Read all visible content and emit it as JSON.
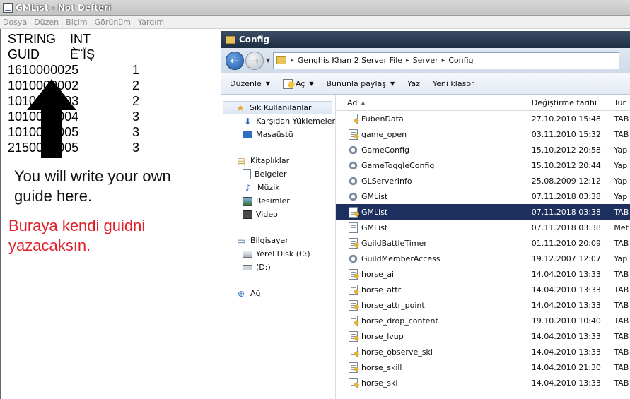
{
  "notepad": {
    "title": "GMList - Not Defteri",
    "menu": [
      "Dosya",
      "Düzen",
      "Biçim",
      "Görünüm",
      "Yardım"
    ],
    "lines": [
      [
        "STRING",
        "INT",
        ""
      ],
      [
        "GUID",
        "È¨ÏŞ",
        ""
      ],
      [
        "1610000025",
        "",
        "1"
      ],
      [
        "1010000002",
        "",
        "2"
      ],
      [
        "1010000003",
        "",
        "2"
      ],
      [
        "1010000004",
        "",
        "3"
      ],
      [
        "1010000005",
        "",
        "3"
      ],
      [
        "2150000005",
        "",
        "3"
      ]
    ],
    "note_en": "You will write your own guide here.",
    "note_tr": "Buraya kendi guidni yazacaksın."
  },
  "explorer": {
    "title": "Config",
    "address": [
      "Genghis Khan 2 Server File",
      "Server",
      "Config"
    ],
    "toolbar": {
      "organize": "Düzenle",
      "open": "Aç",
      "share": "Bununla paylaş",
      "print": "Yaz",
      "new_folder": "Yeni klasör"
    },
    "nav": {
      "favorites": "Sık Kullanılanlar",
      "downloads": "Karşıdan Yüklemeler",
      "desktop": "Masaüstü",
      "libraries": "Kitaplıklar",
      "documents": "Belgeler",
      "music": "Müzik",
      "pictures": "Resimler",
      "video": "Video",
      "computer": "Bilgisayar",
      "local_disk": "Yerel Disk (C:)",
      "drive_d": "(D:)",
      "network": "Ağ"
    },
    "columns": {
      "name": "Ad",
      "date": "Değiştirme tarihi",
      "type": "Tür"
    },
    "files": [
      {
        "name": "FubenData",
        "date": "27.10.2010 15:48",
        "type": "TAB",
        "icon": "txt"
      },
      {
        "name": "game_open",
        "date": "03.11.2010 15:32",
        "type": "TAB",
        "icon": "txt"
      },
      {
        "name": "GameConfig",
        "date": "15.10.2012 20:58",
        "type": "Yap",
        "icon": "cfg"
      },
      {
        "name": "GameToggleConfig",
        "date": "15.10.2012 20:44",
        "type": "Yap",
        "icon": "cfg"
      },
      {
        "name": "GLServerInfo",
        "date": "25.08.2009 12:12",
        "type": "Yap",
        "icon": "cfg"
      },
      {
        "name": "GMList",
        "date": "07.11.2018 03:38",
        "type": "Yap",
        "icon": "cfg"
      },
      {
        "name": "GMList",
        "date": "07.11.2018 03:38",
        "type": "TAB",
        "icon": "txt",
        "selected": true
      },
      {
        "name": "GMList",
        "date": "07.11.2018 03:38",
        "type": "Met",
        "icon": "meta"
      },
      {
        "name": "GuildBattleTimer",
        "date": "01.11.2010 20:09",
        "type": "TAB",
        "icon": "txt"
      },
      {
        "name": "GuildMemberAccess",
        "date": "19.12.2007 12:07",
        "type": "Yap",
        "icon": "cfg"
      },
      {
        "name": "horse_ai",
        "date": "14.04.2010 13:33",
        "type": "TAB",
        "icon": "txt"
      },
      {
        "name": "horse_attr",
        "date": "14.04.2010 13:33",
        "type": "TAB",
        "icon": "txt"
      },
      {
        "name": "horse_attr_point",
        "date": "14.04.2010 13:33",
        "type": "TAB",
        "icon": "txt"
      },
      {
        "name": "horse_drop_content",
        "date": "19.10.2010 10:40",
        "type": "TAB",
        "icon": "txt"
      },
      {
        "name": "horse_lvup",
        "date": "14.04.2010 13:33",
        "type": "TAB",
        "icon": "txt"
      },
      {
        "name": "horse_observe_skl",
        "date": "14.04.2010 13:33",
        "type": "TAB",
        "icon": "txt"
      },
      {
        "name": "horse_skill",
        "date": "14.04.2010 21:30",
        "type": "TAB",
        "icon": "txt"
      },
      {
        "name": "horse_skl",
        "date": "14.04.2010 13:33",
        "type": "TAB",
        "icon": "txt"
      }
    ]
  }
}
